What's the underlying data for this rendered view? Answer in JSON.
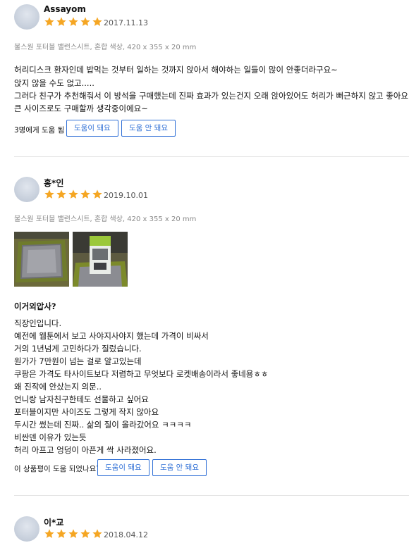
{
  "reviews": [
    {
      "name": "Assayom",
      "rating": 5,
      "date": "2017.11.13",
      "option": "불스원 포터블 밸런스시트, 혼합 색상, 420 x 355 x 20 mm",
      "lines": [
        "허리디스크 환자인데 밥먹는 것부터 일하는 것까지 앉아서 해야하는 일들이 많이 안좋더라구요~",
        "앉지 않을 수도 없고.....",
        "그러다 친구가 추천해줘서 이 방석을 구매했는데 진짜 효과가 있는건지 오래 앉아있어도 허리가 뻐근하지 않고 좋아요.",
        "큰 사이즈로도 구매할까 생각중이에요~"
      ],
      "help_text": "3명에게 도움 됨",
      "helpful_label": "도움이 돼요",
      "not_helpful_label": "도움 안 돼요"
    },
    {
      "name": "홍*인",
      "rating": 5,
      "date": "2019.10.01",
      "option": "불스원 포터블 밸런스시트, 혼합 색상, 420 x 355 x 20 mm",
      "headline": "이거외압사?",
      "lines": [
        "직장인입니다.",
        "예전에 웹툰에서 보고 사야지사야지 했는데 가격이 비싸서",
        "거의 1년넘게 고민하다가 질렀습니다.",
        "원가가 7만원이 넘는 걸로 알고있는데",
        "쿠팡은 가격도 타사이트보다 저렴하고 무엇보다 로켓배송이라서 좋네용ㅎㅎ",
        "왜 진작에 안샀는지 의문..",
        "언니랑 남자친구한테도 선물하고 싶어요",
        "포터블이지만 사이즈도 그렇게 작지 않아요",
        "두시간 썼는데 진짜.. 삶의 질이 올라갔어요 ㅋㅋㅋㅋ",
        "비싼덴 이유가 있는듯",
        "허리 아프고 엉덩이 아픈게 싹 사라졌어요."
      ],
      "help_text": "이 상품평이 도움 되었나요?",
      "helpful_label": "도움이 돼요",
      "not_helpful_label": "도움 안 돼요"
    },
    {
      "name": "이*교",
      "rating": 5,
      "date": "2018.04.12"
    }
  ],
  "colors": {
    "star": "#f5a623",
    "button": "#2f6fd6",
    "divider": "#e3e3e3"
  },
  "icons": {
    "star": "star-icon",
    "avatar": "user-avatar"
  }
}
